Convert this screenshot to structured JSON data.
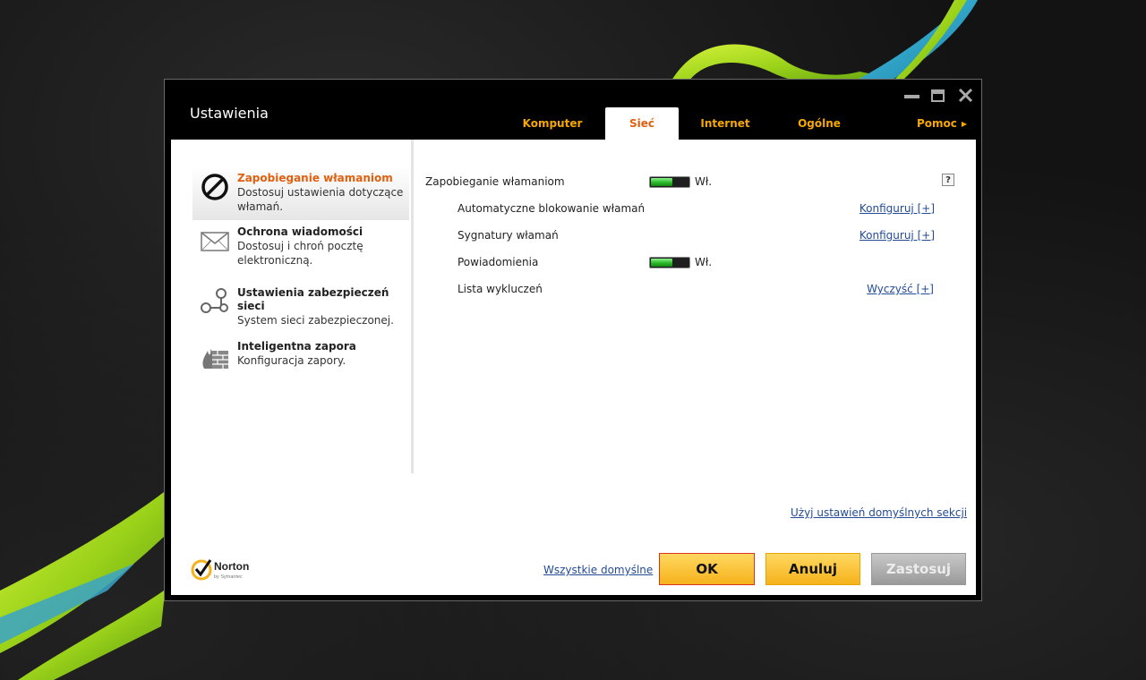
{
  "window": {
    "title": "Ustawienia",
    "controls": [
      "minimize-icon",
      "maximize-icon",
      "close-icon"
    ]
  },
  "tabs": [
    {
      "label": "Komputer",
      "active": false
    },
    {
      "label": "Sieć",
      "active": true
    },
    {
      "label": "Internet",
      "active": false
    },
    {
      "label": "Ogólne",
      "active": false
    },
    {
      "label": "Pomoc",
      "active": false
    }
  ],
  "sidebar": {
    "items": [
      {
        "title": "Zapobieganie włamaniom",
        "desc1": "Dostosuj ustawienia dotyczące",
        "desc2": "włamań.",
        "icon": "no-entry-icon",
        "active": true
      },
      {
        "title": "Ochrona wiadomości",
        "desc1": "Dostosuj i chroń pocztę",
        "desc2": "elektroniczną.",
        "icon": "envelope-icon",
        "active": false
      },
      {
        "title": "Ustawienia zabezpieczeń sieci",
        "desc1": "System sieci zabezpieczonej.",
        "icon": "network-icon",
        "active": false
      },
      {
        "title": "Inteligentna zapora",
        "desc1": "Konfiguracja zapory.",
        "icon": "firewall-icon",
        "active": false
      }
    ]
  },
  "settings": {
    "rows": [
      {
        "label": "Zapobieganie włamaniom",
        "toggle_text": "Wł.",
        "on": true,
        "help": "?"
      },
      {
        "label": "Automatyczne blokowanie włamań",
        "link": "Konfiguruj [+]"
      },
      {
        "label": "Sygnatury włamań",
        "link": "Konfiguruj [+]"
      },
      {
        "label": "Powiadomienia",
        "toggle_text": "Wł.",
        "on": true
      },
      {
        "label": "Lista wykluczeń",
        "link": "Wyczyść [+]"
      }
    ]
  },
  "footer": {
    "default_section_link": "Użyj ustawień domyślnych sekcji",
    "all_defaults_link": "Wszystkie domyślne",
    "ok": "OK",
    "cancel": "Anuluj",
    "apply": "Zastosuj",
    "logo": {
      "brand": "Norton",
      "sub": "by Symantec"
    }
  },
  "colors": {
    "accent_orange": "#e06010",
    "tab_gold": "#f6a800",
    "button_gold": "#f6b21c",
    "toggle_green": "#2fbf2f",
    "link_blue": "#234b96"
  }
}
